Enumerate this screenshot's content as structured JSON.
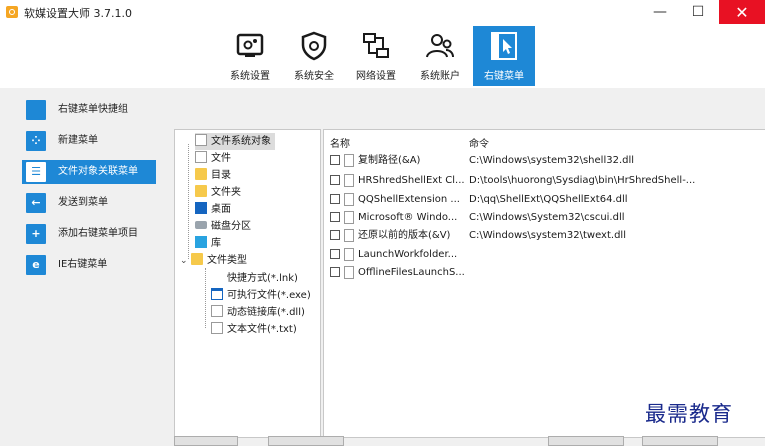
{
  "window": {
    "title": "软媒设置大师 3.7.1.0",
    "minimize": "—",
    "maximize": "☐",
    "close": "✕"
  },
  "toolbar": [
    {
      "label": "系统设置",
      "icon": "gear-monitor-icon"
    },
    {
      "label": "系统安全",
      "icon": "shield-icon"
    },
    {
      "label": "网络设置",
      "icon": "network-icon"
    },
    {
      "label": "系统账户",
      "icon": "users-icon"
    },
    {
      "label": "右键菜单",
      "icon": "cursor-icon",
      "active": true
    }
  ],
  "sidebar": [
    {
      "label": "右键菜单快捷组",
      "icon": "menu-group-icon",
      "glyph": ""
    },
    {
      "label": "新建菜单",
      "icon": "new-menu-icon",
      "glyph": "⁘"
    },
    {
      "label": "文件对象关联菜单",
      "icon": "file-assoc-icon",
      "glyph": "☰",
      "active": true
    },
    {
      "label": "发送到菜单",
      "icon": "send-to-icon",
      "glyph": "←"
    },
    {
      "label": "添加右键菜单项目",
      "icon": "add-item-icon",
      "glyph": "+"
    },
    {
      "label": "IE右键菜单",
      "icon": "ie-icon",
      "glyph": "e"
    }
  ],
  "tree": {
    "root": "文件系统对象",
    "items": [
      "文件",
      "目录",
      "文件夹",
      "桌面",
      "磁盘分区",
      "库"
    ],
    "types_label": "文件类型",
    "types": [
      "快捷方式(*.lnk)",
      "可执行文件(*.exe)",
      "动态链接库(*.dll)",
      "文本文件(*.txt)"
    ]
  },
  "list": {
    "col_name": "名称",
    "col_cmd": "命令",
    "rows": [
      {
        "name": "复制路径(&A)",
        "cmd": "C:\\Windows\\system32\\shell32.dll"
      },
      {
        "name": "HRShredShellExt Cl...",
        "cmd": "D:\\tools\\huorong\\Sysdiag\\bin\\HrShredShell-..."
      },
      {
        "name": "QQShellExtension ...",
        "cmd": "D:\\qq\\ShellExt\\QQShellExt64.dll"
      },
      {
        "name": "Microsoft® Windo...",
        "cmd": "C:\\Windows\\System32\\cscui.dll"
      },
      {
        "name": "还原以前的版本(&V)",
        "cmd": "C:\\Windows\\system32\\twext.dll"
      },
      {
        "name": "LaunchWorkfolder...",
        "cmd": ""
      },
      {
        "name": "OfflineFilesLaunchS...",
        "cmd": ""
      }
    ]
  },
  "watermark": "最需教育",
  "colors": {
    "accent": "#1e88d6",
    "close": "#e81123",
    "watermark": "#1a2a8c"
  }
}
